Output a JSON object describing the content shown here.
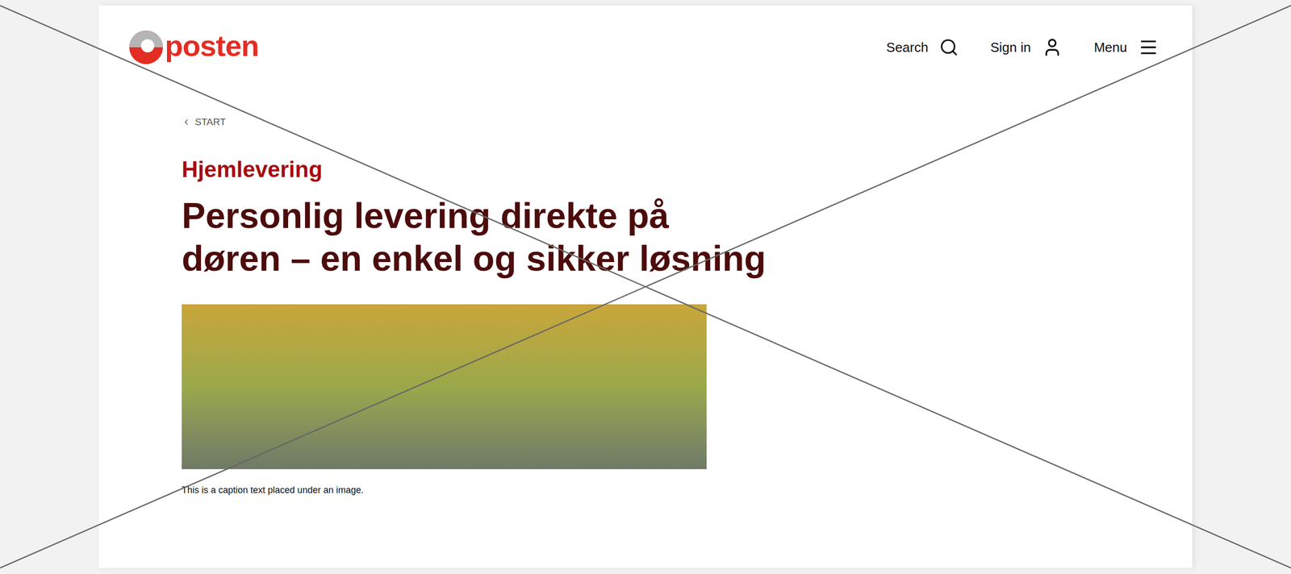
{
  "header": {
    "logo": "posten",
    "nav": [
      {
        "label": "Search",
        "icon": "search"
      },
      {
        "label": "Sign in",
        "icon": "user"
      },
      {
        "label": "Menu",
        "icon": "menu"
      }
    ]
  },
  "breadcrumb": {
    "label": "START"
  },
  "article": {
    "eyebrow": "Hjemlevering",
    "title": "Personlig levering direkte på døren – en enkel og sikker løsning",
    "caption": "This is a caption text placed under an image."
  }
}
